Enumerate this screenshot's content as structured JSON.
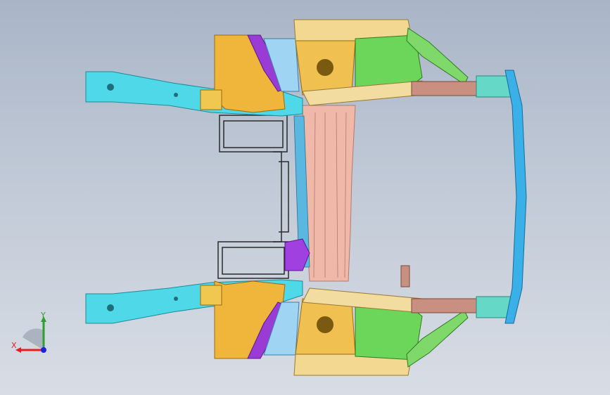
{
  "viewport": {
    "background_top": "#a9b5c7",
    "background_bottom": "#d8dde5"
  },
  "triad": {
    "x_label": "X",
    "y_label": "Y",
    "x_color": "#e02020",
    "y_color": "#2ca02c",
    "z_color": "#2020e0"
  },
  "model": {
    "part_colors": {
      "rail": "#4fd8e8",
      "rail_dark": "#2bb7c9",
      "gold": "#f0b63c",
      "tan": "#f2dca0",
      "pink": "#f0b8a8",
      "green": "#6bd65a",
      "purple": "#9a3bd6",
      "blue_panel": "#7fc8f0",
      "bumper": "#3ab0e8",
      "crash_box": "#c98f80",
      "black_frame": "#2a2a2a"
    }
  }
}
